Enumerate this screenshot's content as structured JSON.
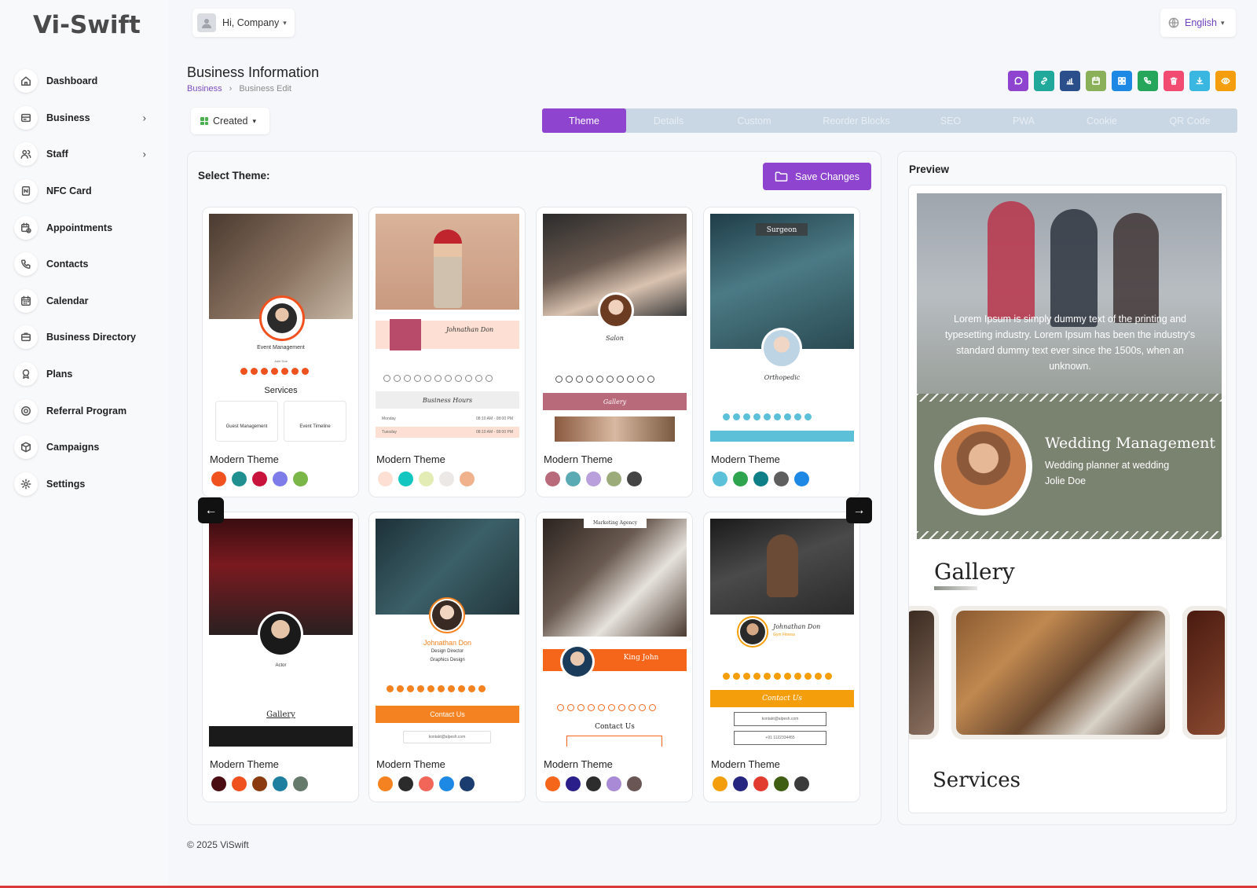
{
  "app": {
    "logo": "Vi-Swift"
  },
  "user": {
    "greeting": "Hi, Company"
  },
  "language": {
    "label": "English"
  },
  "sidebar": {
    "items": [
      {
        "label": "Dashboard",
        "icon": "home-icon",
        "has_children": false
      },
      {
        "label": "Business",
        "icon": "business-icon",
        "has_children": true
      },
      {
        "label": "Staff",
        "icon": "staff-icon",
        "has_children": true
      },
      {
        "label": "NFC Card",
        "icon": "nfc-icon",
        "has_children": false
      },
      {
        "label": "Appointments",
        "icon": "appointments-icon",
        "has_children": false
      },
      {
        "label": "Contacts",
        "icon": "phone-icon",
        "has_children": false
      },
      {
        "label": "Calendar",
        "icon": "calendar-icon",
        "has_children": false
      },
      {
        "label": "Business Directory",
        "icon": "directory-icon",
        "has_children": false
      },
      {
        "label": "Plans",
        "icon": "plans-icon",
        "has_children": false
      },
      {
        "label": "Referral Program",
        "icon": "referral-icon",
        "has_children": false
      },
      {
        "label": "Campaigns",
        "icon": "campaigns-icon",
        "has_children": false
      },
      {
        "label": "Settings",
        "icon": "settings-icon",
        "has_children": false
      }
    ]
  },
  "page": {
    "title": "Business Information",
    "breadcrumb": {
      "parent": "Business",
      "sep": "›",
      "current": "Business Edit"
    }
  },
  "actions": [
    {
      "name": "whatsapp",
      "color": "#8e44ce"
    },
    {
      "name": "link",
      "color": "#20a89a"
    },
    {
      "name": "analytics",
      "color": "#2a4f8a"
    },
    {
      "name": "calendar",
      "color": "#8bb05a"
    },
    {
      "name": "qr-grid",
      "color": "#1e88e5"
    },
    {
      "name": "phone",
      "color": "#26a65b"
    },
    {
      "name": "delete",
      "color": "#f24b72"
    },
    {
      "name": "download",
      "color": "#3ab7e0"
    },
    {
      "name": "view",
      "color": "#f59e0b"
    }
  ],
  "filter": {
    "label": "Created"
  },
  "tabs": [
    {
      "label": "Theme",
      "active": true
    },
    {
      "label": "Details",
      "active": false
    },
    {
      "label": "Custom",
      "active": false
    },
    {
      "label": "Reorder Blocks",
      "active": false
    },
    {
      "label": "SEO",
      "active": false
    },
    {
      "label": "PWA",
      "active": false
    },
    {
      "label": "Cookie",
      "active": false
    },
    {
      "label": "QR Code",
      "active": false
    }
  ],
  "theme_panel": {
    "title": "Select Theme:",
    "save_label": "Save Changes",
    "prev_label": "←",
    "next_label": "→",
    "themes": [
      {
        "title": "Modern Theme",
        "colors": [
          "#f0521f",
          "#1f8f8f",
          "#c8143c",
          "#7d7ce8",
          "#7ab648"
        ]
      },
      {
        "title": "Modern Theme",
        "colors": [
          "#fde0d3",
          "#13c7c0",
          "#e2ecb4",
          "#ece8e6",
          "#efb28d"
        ]
      },
      {
        "title": "Modern Theme",
        "colors": [
          "#b8697a",
          "#5aaab4",
          "#b9a0dc",
          "#9bac7a",
          "#444444"
        ]
      },
      {
        "title": "Modern Theme",
        "colors": [
          "#5bc0d8",
          "#2ea44f",
          "#0e7f86",
          "#5e5e5e",
          "#1e88e5"
        ]
      },
      {
        "title": "Modern Theme",
        "colors": [
          "#4a0d12",
          "#f0521f",
          "#8a3c10",
          "#1e7fa0",
          "#667a6c"
        ]
      },
      {
        "title": "Modern Theme",
        "colors": [
          "#f58220",
          "#2b2b2b",
          "#f26659",
          "#1e88e5",
          "#1a3c6e"
        ]
      },
      {
        "title": "Modern Theme",
        "colors": [
          "#f5661a",
          "#2a1f8a",
          "#2d2d2d",
          "#a98ad6",
          "#6b5656"
        ]
      },
      {
        "title": "Modern Theme",
        "colors": [
          "#f59e0b",
          "#262680",
          "#e23b2f",
          "#3f5e12",
          "#3b3b3b"
        ]
      }
    ],
    "mini": {
      "t1_role": "Event Management",
      "t1_person": "Jolie Doe",
      "t1_services": "Services",
      "t1_s1": "Guest Management",
      "t1_s2": "Event Timeline",
      "t2_name": "Johnathan Don",
      "t2_hours": "Business Hours",
      "t2_r1_day": "Monday",
      "t2_r1_time": "08:10 AM - 08:00 PM",
      "t2_r2_day": "Tuesday",
      "t2_r2_time": "08:10 AM - 08:00 PM",
      "t3_name": "Salon",
      "t3_gallery": "Gallery",
      "t4_top": "Surgeon",
      "t4_role": "Orthopedic",
      "t5_role": "Actor",
      "t5_gallery": "Gallery",
      "t6_name": "Johnathan Don",
      "t6_role": "Design Director",
      "t6_sub": "Graphics Design",
      "t6_contact": "Contact Us",
      "t6_email": "kontakt@alpesh.com",
      "t7_top": "Marketing Agency",
      "t7_name": "King John",
      "t7_contact": "Contact Us",
      "t8_name": "Johnathan Don",
      "t8_sub": "Gym Fitness",
      "t8_contact": "Contact Us",
      "t8_email": "kontakt@alpesh.com",
      "t8_phone": "+91 1122334455"
    }
  },
  "preview": {
    "title": "Preview",
    "hero_text": "Lorem Ipsum is simply dummy text of the printing and typesetting industry. Lorem Ipsum has been the industry's standard dummy text ever since the 1500s, when an unknown.",
    "name": "Wedding Management",
    "role": "Wedding planner at wedding",
    "person": "Jolie Doe",
    "gallery_title": "Gallery",
    "services_title": "Services"
  },
  "footer": {
    "text": "© 2025 ViSwift"
  }
}
